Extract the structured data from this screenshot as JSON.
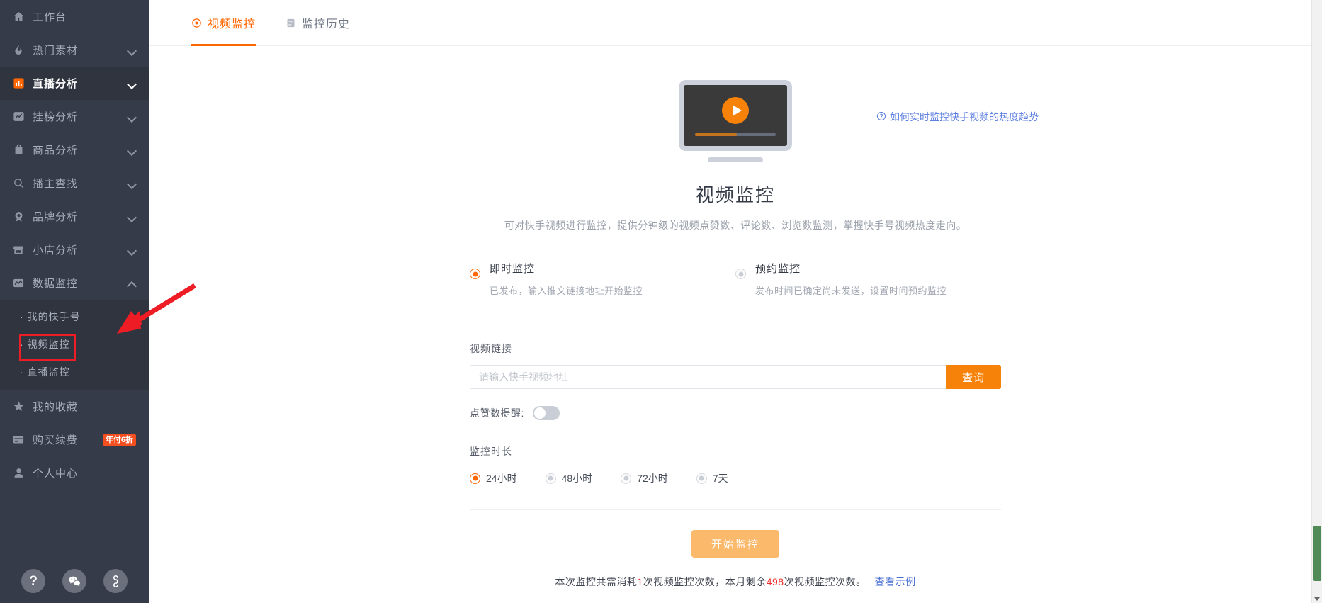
{
  "sidebar": {
    "items": [
      {
        "label": "工作台",
        "icon": "home-icon",
        "expandable": false,
        "active": false
      },
      {
        "label": "热门素材",
        "icon": "fire-icon",
        "expandable": true,
        "active": false
      },
      {
        "label": "直播分析",
        "icon": "bar-chart-icon",
        "expandable": true,
        "active": true
      },
      {
        "label": "挂榜分析",
        "icon": "line-chart-icon",
        "expandable": true,
        "active": false
      },
      {
        "label": "商品分析",
        "icon": "bag-icon",
        "expandable": true,
        "active": false
      },
      {
        "label": "播主查找",
        "icon": "search-icon",
        "expandable": true,
        "active": false
      },
      {
        "label": "品牌分析",
        "icon": "medal-icon",
        "expandable": true,
        "active": false
      },
      {
        "label": "小店分析",
        "icon": "shop-icon",
        "expandable": true,
        "active": false
      },
      {
        "label": "数据监控",
        "icon": "monitor-icon",
        "expandable": true,
        "expanded": true,
        "active": false
      }
    ],
    "sub_items": [
      {
        "label": "我的快手号",
        "bullet": "·",
        "selected": false
      },
      {
        "label": "视频监控",
        "bullet": "·",
        "selected": true
      },
      {
        "label": "直播监控",
        "bullet": "·",
        "selected": false
      }
    ],
    "bottom_items": [
      {
        "label": "我的收藏",
        "icon": "star-icon"
      },
      {
        "label": "购买续费",
        "icon": "card-icon",
        "badge": "年付6折"
      },
      {
        "label": "个人中心",
        "icon": "user-icon"
      }
    ],
    "float_buttons": [
      {
        "name": "help-icon",
        "glyph": "?"
      },
      {
        "name": "wechat-icon",
        "glyph": "wechat"
      },
      {
        "name": "link-icon",
        "glyph": "link"
      }
    ],
    "badge_color": "#f54e1f",
    "accent_color": "#ff6600"
  },
  "tabs": [
    {
      "label": "视频监控",
      "icon": "eye-target-icon",
      "active": true
    },
    {
      "label": "监控历史",
      "icon": "list-doc-icon",
      "active": false
    }
  ],
  "help_link": {
    "text": "如何实时监控快手视频的热度趋势",
    "icon": "question-circle-icon",
    "color": "#5c7fe0"
  },
  "hero": {
    "illustration": "video-player-illustration",
    "title": "视频监控",
    "subtitle": "可对快手视频进行监控，提供分钟级的视频点赞数、评论数、浏览数监测，掌握快手号视频热度走向。"
  },
  "modes": [
    {
      "title": "即时监控",
      "desc": "已发布，输入推文链接地址开始监控",
      "selected": true
    },
    {
      "title": "预约监控",
      "desc": "发布时间已确定尚未发送，设置时间预约监控",
      "selected": false
    }
  ],
  "form": {
    "link_label": "视频链接",
    "link_value": "",
    "link_placeholder": "请输入快手视频地址",
    "query_button": "查询",
    "toggle_label": "点赞数提醒:",
    "toggle_on": false,
    "duration_label": "监控时长",
    "duration_options": [
      {
        "label": "24小时",
        "selected": true
      },
      {
        "label": "48小时",
        "selected": false
      },
      {
        "label": "72小时",
        "selected": false
      },
      {
        "label": "7天",
        "selected": false
      }
    ],
    "submit_button": "开始监控"
  },
  "footer": {
    "prefix": "本次监控共需消耗",
    "cost": "1",
    "middle": "次视频监控次数，本月剩余",
    "remaining": "498",
    "suffix": "次视频监控次数。",
    "example_link": "查看示例"
  }
}
